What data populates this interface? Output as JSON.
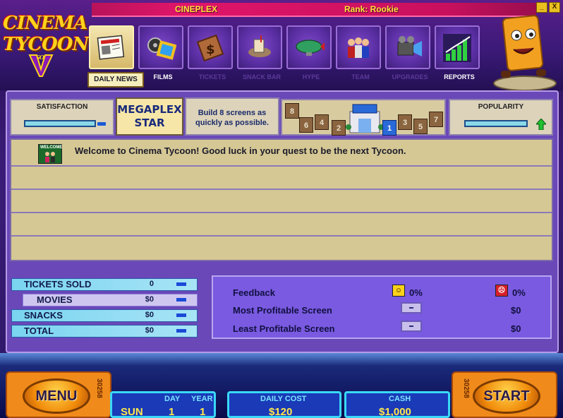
{
  "window": {
    "app_name": "CINEPLEX",
    "rank": "Rank: Rookie",
    "controls": [
      "_",
      "X"
    ]
  },
  "logo": {
    "line1": "CINEMA",
    "line2": "TYCOON",
    "badge": "GOLD"
  },
  "nav": {
    "tabs": [
      {
        "label": "DAILY NEWS",
        "icon": "newspaper-icon"
      },
      {
        "label": "FILMS",
        "icon": "film-reel-icon"
      },
      {
        "label": "TICKETS",
        "icon": "ticket-icon"
      },
      {
        "label": "SNACK BAR",
        "icon": "snack-icon"
      },
      {
        "label": "HYPE",
        "icon": "blimp-icon"
      },
      {
        "label": "TEAM",
        "icon": "staff-icon"
      },
      {
        "label": "UPGRADES",
        "icon": "projector-icon"
      },
      {
        "label": "REPORTS",
        "icon": "chart-icon"
      }
    ]
  },
  "status": {
    "satisfaction_label": "SATISFACTION",
    "popularity_label": "POPULARITY",
    "goal_title_1": "MEGAPLEX",
    "goal_title_2": "STAR",
    "goal_desc_1": "Build 8 screens as",
    "goal_desc_2": "quickly as possible.",
    "screens": [
      "8",
      "6",
      "4",
      "2",
      "1",
      "3",
      "5",
      "7"
    ]
  },
  "news": {
    "icon_label": "WELCOME",
    "message": "Welcome to Cinema Tycoon! Good luck in your quest to be the next Tycoon."
  },
  "stats": {
    "tickets_sold_label": "TICKETS SOLD",
    "tickets_sold": "0",
    "movies_label": "MOVIES",
    "movies": "$0",
    "snacks_label": "SNACKS",
    "snacks": "$0",
    "total_label": "TOTAL",
    "total": "$0",
    "feedback_label": "Feedback",
    "feedback_positive": "0%",
    "feedback_negative": "0%",
    "most_profitable_label": "Most Profitable Screen",
    "most_profitable_value": "$0",
    "least_profitable_label": "Least Profitable Screen",
    "least_profitable_value": "$0"
  },
  "bottom": {
    "menu_label": "MENU",
    "start_label": "START",
    "day_label": "DAY",
    "year_label": "YEAR",
    "weekday": "SUN",
    "day": "1",
    "year": "1",
    "daily_cost_label": "DAILY COST",
    "daily_cost": "$120",
    "cash_label": "CASH",
    "cash": "$1,000",
    "ticket_numbers": [
      "30258",
      "30258",
      "30258",
      "30258"
    ]
  },
  "colors": {
    "accent_gold": "#ffd21a",
    "title_strip": "#e0156a",
    "info_border": "#3ad8f6"
  }
}
